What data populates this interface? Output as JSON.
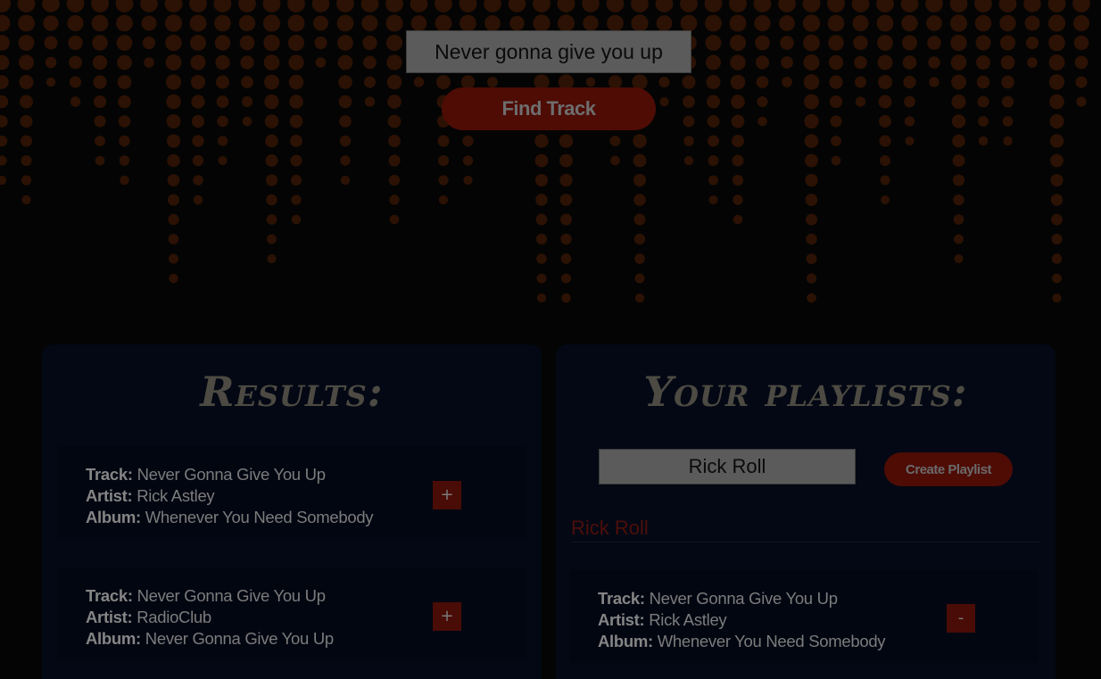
{
  "search": {
    "value": "Never gonna give you up",
    "button_label": "Find Track"
  },
  "results": {
    "title": "Results:",
    "field_labels": {
      "track": "Track:",
      "artist": "Artist:",
      "album": "Album:"
    },
    "add_label": "+",
    "items": [
      {
        "track": "Never Gonna Give You Up",
        "artist": "Rick Astley",
        "album": "Whenever You Need Somebody"
      },
      {
        "track": "Never Gonna Give You Up",
        "artist": "RadioClub",
        "album": "Never Gonna Give You Up"
      }
    ]
  },
  "playlists": {
    "title": "Your playlists:",
    "new_playlist_value": "Rick Roll",
    "create_label": "Create Playlist",
    "remove_label": "-",
    "lists": [
      {
        "name": "Rick Roll",
        "tracks": [
          {
            "track": "Never Gonna Give You Up",
            "artist": "Rick Astley",
            "album": "Whenever You Need Somebody"
          }
        ]
      }
    ]
  },
  "colors": {
    "background": "#040404",
    "panel": "#030814",
    "accent": "#4e0c05",
    "dots": "#2c1204"
  }
}
